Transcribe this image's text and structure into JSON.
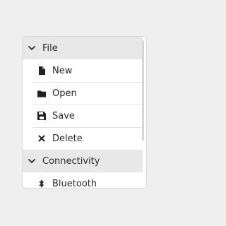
{
  "menu": {
    "groups": [
      {
        "label": "File",
        "icon": "chevron-down-icon",
        "items": [
          {
            "label": "New",
            "icon": "file-icon"
          },
          {
            "label": "Open",
            "icon": "folder-icon"
          },
          {
            "label": "Save",
            "icon": "floppy-disk-icon"
          },
          {
            "label": "Delete",
            "icon": "x-icon"
          }
        ]
      },
      {
        "label": "Connectivity",
        "icon": "chevron-down-icon",
        "items": [
          {
            "label": "Bluetooth",
            "icon": "bluetooth-icon"
          }
        ]
      }
    ]
  },
  "colors": {
    "background": "#efefef",
    "panel": "#ffffff",
    "header": "#e8e8e8",
    "text": "#2b2b2b",
    "separator": "#e2e2e2",
    "scrollbar": "#d6d6d6"
  }
}
